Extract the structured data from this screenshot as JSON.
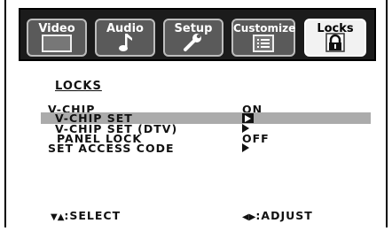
{
  "tabs": [
    {
      "label": "Video",
      "icon": "video-screen-icon",
      "active": false
    },
    {
      "label": "Audio",
      "icon": "music-note-icon",
      "active": false
    },
    {
      "label": "Setup",
      "icon": "wrench-icon",
      "active": false
    },
    {
      "label": "Customize",
      "icon": "list-icon",
      "active": false
    },
    {
      "label": "Locks",
      "icon": "padlock-icon",
      "active": true
    }
  ],
  "menu": {
    "title": "LOCKS",
    "items": [
      {
        "label": "V-CHIP",
        "value": "ON",
        "value_type": "text",
        "highlighted": false
      },
      {
        "label": "V-CHIP SET",
        "value": "",
        "value_type": "arrow-selected",
        "highlighted": true
      },
      {
        "label": "V-CHIP SET (DTV)",
        "value": "",
        "value_type": "arrow",
        "highlighted": false
      },
      {
        "label": "PANEL LOCK",
        "value": "OFF",
        "value_type": "text",
        "highlighted": false
      },
      {
        "label": "SET ACCESS CODE",
        "value": "",
        "value_type": "arrow",
        "highlighted": false
      }
    ]
  },
  "footer": {
    "select_symbol": "▼▲",
    "select_label": ":SELECT",
    "adjust_symbol": "◀▶",
    "adjust_label": ":ADJUST"
  },
  "colors": {
    "tabbar_bg": "#1b1b1b",
    "tab_bg": "#5a5a5a",
    "tab_active_bg": "#f2f2f2",
    "highlight": "#ababab"
  }
}
